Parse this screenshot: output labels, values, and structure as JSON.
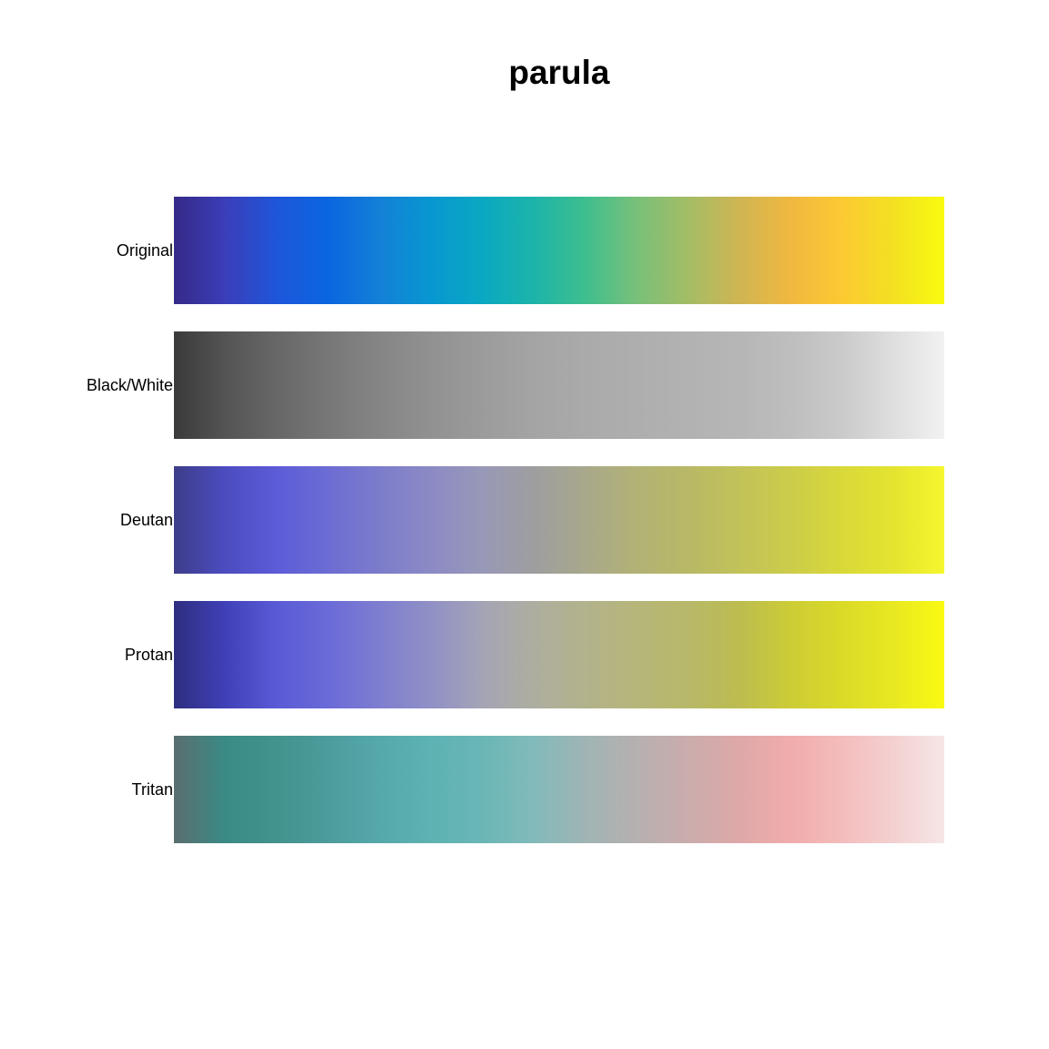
{
  "chart_data": {
    "type": "heatmap",
    "title": "parula",
    "rows": [
      {
        "label": "Original",
        "colors": [
          "#352A87",
          "#3B3EB9",
          "#1E56DA",
          "#0A66E0",
          "#1480D6",
          "#0897D1",
          "#0AA8C2",
          "#1CB4AA",
          "#3EBE8F",
          "#78C07A",
          "#A3BD66",
          "#CFB553",
          "#F0B840",
          "#FCC932",
          "#F3E022",
          "#F9FB0E"
        ]
      },
      {
        "label": "Black/White",
        "colors": [
          "#3A3A3A",
          "#545454",
          "#676767",
          "#777777",
          "#858585",
          "#919191",
          "#9B9B9B",
          "#A4A4A4",
          "#AAAAAA",
          "#AEAEAE",
          "#B2B2B2",
          "#B6B6B6",
          "#BEBEBE",
          "#CACACA",
          "#DEDEDE",
          "#F2F2F2"
        ]
      },
      {
        "label": "Deutan",
        "colors": [
          "#3D3D8A",
          "#4C4CC0",
          "#5C5CD8",
          "#6C6CD4",
          "#7C7CCC",
          "#8C8AC4",
          "#9898B8",
          "#9E9EA0",
          "#A8A88C",
          "#B2B276",
          "#B8B866",
          "#C2C25A",
          "#CCCC4A",
          "#D8D83A",
          "#E4E430",
          "#F6F62E"
        ]
      },
      {
        "label": "Protan",
        "colors": [
          "#2E2E80",
          "#4040B8",
          "#5A5AD6",
          "#6A6AD8",
          "#7E7ED0",
          "#9090C6",
          "#A4A4B6",
          "#AEAEA0",
          "#B2B28C",
          "#B6B67A",
          "#B8B86A",
          "#BCBC50",
          "#CCCC36",
          "#DADA28",
          "#E8E822",
          "#FAFA12"
        ]
      },
      {
        "label": "Tritan",
        "colors": [
          "#5A6E6E",
          "#3A8A86",
          "#42928E",
          "#4C9C9C",
          "#56A8AA",
          "#5EB2B2",
          "#6AB6B6",
          "#82BABA",
          "#A0B4B4",
          "#B6B0B0",
          "#CAACAC",
          "#DEA8A8",
          "#F0ACAC",
          "#F4BCBC",
          "#F4D0D0",
          "#F6E6E6"
        ]
      }
    ]
  }
}
